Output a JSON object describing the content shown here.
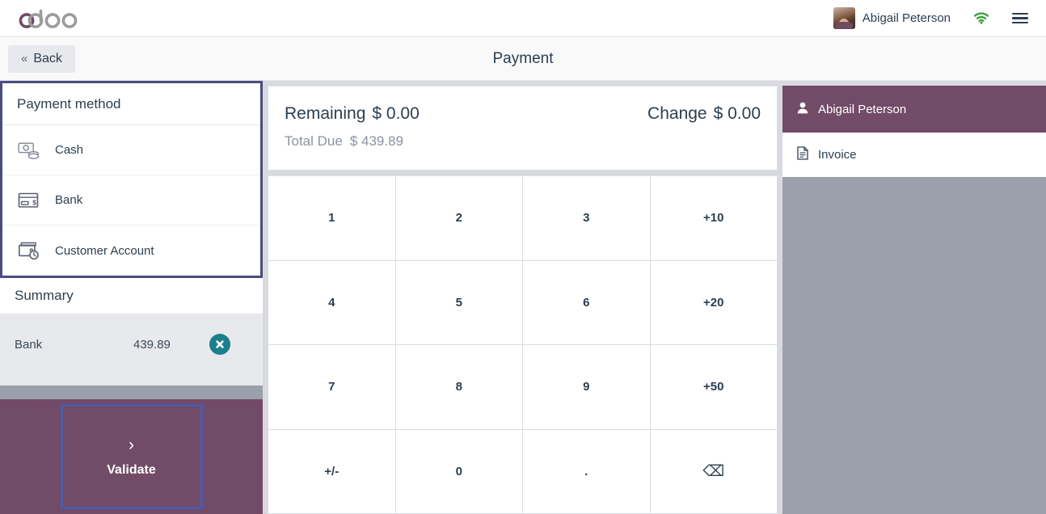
{
  "topbar": {
    "logo_text": "odoo",
    "logo_accent_color": "#714B67",
    "logo_gray_color": "#9B9B9B",
    "username": "Abigail Peterson",
    "avatar_icon": "user-avatar-photo",
    "wifi_icon": "wifi-icon",
    "wifi_color": "#3BA33B",
    "menu_icon": "hamburger-menu-icon"
  },
  "subheader": {
    "back_label": "Back",
    "back_chevron": "«",
    "title": "Payment"
  },
  "payment_methods": {
    "header": "Payment method",
    "border_color": "#4B4B83",
    "items": [
      {
        "label": "Cash",
        "icon": "cash-banknote-icon"
      },
      {
        "label": "Bank",
        "icon": "credit-card-icon"
      },
      {
        "label": "Customer Account",
        "icon": "wallet-clock-icon"
      }
    ]
  },
  "summary": {
    "header": "Summary",
    "rows": [
      {
        "label": "Bank",
        "amount": "439.89",
        "delete_icon": "close-circle-icon"
      }
    ],
    "delete_color": "#1B7F8E"
  },
  "validate": {
    "label": "Validate",
    "chevron": "›",
    "background": "#714B67",
    "border_color": "#4C5BA8"
  },
  "totals": {
    "remaining_label": "Remaining",
    "remaining_value": "$ 0.00",
    "change_label": "Change",
    "change_value": "$ 0.00",
    "total_due_label": "Total Due",
    "total_due_value": "$ 439.89"
  },
  "numpad": {
    "keys": [
      {
        "label": "1",
        "name": "numpad-1"
      },
      {
        "label": "2",
        "name": "numpad-2"
      },
      {
        "label": "3",
        "name": "numpad-3"
      },
      {
        "label": "+10",
        "name": "numpad-plus-10"
      },
      {
        "label": "4",
        "name": "numpad-4"
      },
      {
        "label": "5",
        "name": "numpad-5"
      },
      {
        "label": "6",
        "name": "numpad-6"
      },
      {
        "label": "+20",
        "name": "numpad-plus-20"
      },
      {
        "label": "7",
        "name": "numpad-7"
      },
      {
        "label": "8",
        "name": "numpad-8"
      },
      {
        "label": "9",
        "name": "numpad-9"
      },
      {
        "label": "+50",
        "name": "numpad-plus-50"
      },
      {
        "label": "+/-",
        "name": "numpad-sign-toggle"
      },
      {
        "label": "0",
        "name": "numpad-0"
      },
      {
        "label": ".",
        "name": "numpad-decimal"
      },
      {
        "label": "⌫",
        "name": "numpad-backspace"
      }
    ]
  },
  "right_panel": {
    "customer_label": "Abigail Peterson",
    "customer_icon": "person-icon",
    "customer_background": "#714B67",
    "invoice_label": "Invoice",
    "invoice_icon": "document-icon"
  }
}
